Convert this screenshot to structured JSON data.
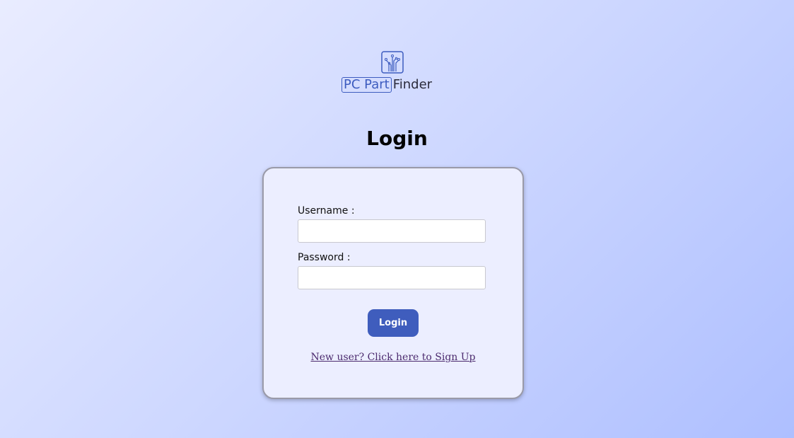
{
  "logo": {
    "brand_boxed": "PC Part",
    "brand_rest": "Finder",
    "icon": "circuit-chip-icon",
    "accent_color": "#3d5cbf"
  },
  "page": {
    "title": "Login"
  },
  "form": {
    "username_label": "Username :",
    "username_value": "",
    "password_label": "Password :",
    "password_value": "",
    "login_button": "Login",
    "signup_link": "New user? Click here to Sign Up"
  },
  "colors": {
    "button": "#3f5dbd",
    "link": "#4b2a6e",
    "card_bg": "#eceeff"
  }
}
